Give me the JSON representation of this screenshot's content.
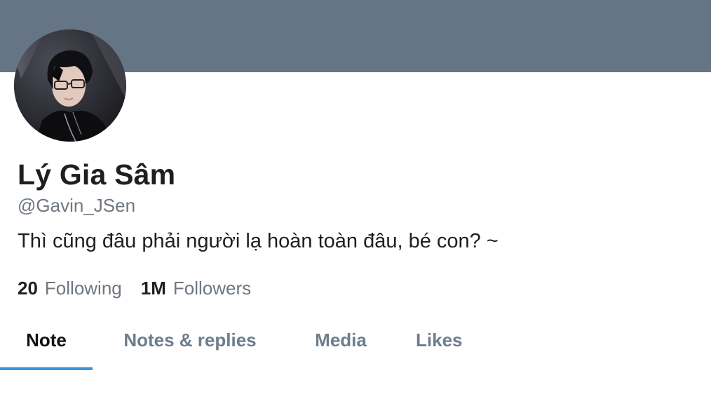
{
  "profile": {
    "display_name": "Lý Gia Sâm",
    "handle": "@Gavin_JSen",
    "bio": "Thì cũng đâu phải người lạ hoàn toàn đâu, bé con? ~",
    "avatar_icon": "profile-photo",
    "banner_color": "#667585"
  },
  "stats": {
    "following_count": "20",
    "following_label": "Following",
    "followers_count": "1M",
    "followers_label": "Followers"
  },
  "tabs": [
    {
      "label": "Note",
      "active": true
    },
    {
      "label": "Notes & replies",
      "active": false
    },
    {
      "label": "Media",
      "active": false
    },
    {
      "label": "Likes",
      "active": false
    }
  ],
  "colors": {
    "accent": "#3b94d9",
    "text_primary": "#1f1f1f",
    "text_secondary": "#6e7781"
  }
}
